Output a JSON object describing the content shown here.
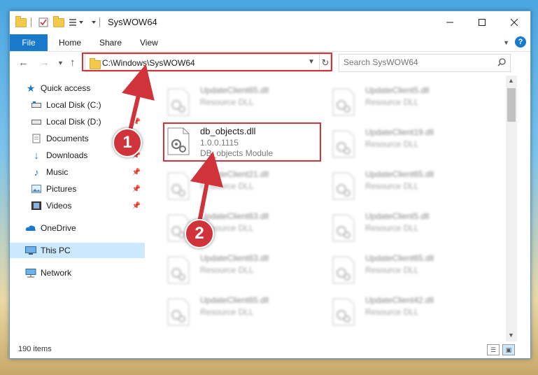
{
  "window": {
    "title": "SysWOW64"
  },
  "ribbon": {
    "tabs": [
      "File",
      "Home",
      "Share",
      "View"
    ],
    "help": "?"
  },
  "address": {
    "path": "C:\\Windows\\SysWOW64",
    "search_placeholder": "Search SysWOW64"
  },
  "sidebar": {
    "items": [
      {
        "label": "Quick access"
      },
      {
        "label": "Local Disk (C:)"
      },
      {
        "label": "Local Disk (D:)"
      },
      {
        "label": "Documents"
      },
      {
        "label": "Downloads"
      },
      {
        "label": "Music"
      },
      {
        "label": "Pictures"
      },
      {
        "label": "Videos"
      },
      {
        "label": "OneDrive"
      },
      {
        "label": "This PC"
      },
      {
        "label": "Network"
      }
    ]
  },
  "files": {
    "focus": {
      "name": "db_objects.dll",
      "version": "1.0.0.1115",
      "description": "DB_objects Module"
    },
    "left": [
      {
        "name": "UpdateClient65.dll",
        "desc": "Resource DLL"
      },
      {
        "name": "UpdateClient21.dll",
        "desc": "Resource DLL"
      },
      {
        "name": "UpdateClient63.dll",
        "desc": "Resource DLL"
      },
      {
        "name": "UpdateClient63.dll",
        "desc": "Resource DLL"
      },
      {
        "name": "UpdateClient65.dll",
        "desc": "Resource DLL"
      }
    ],
    "right": [
      {
        "name": "UpdateClient5.dll",
        "desc": "Resource DLL"
      },
      {
        "name": "UpdateClient19.dll",
        "desc": "Resource DLL"
      },
      {
        "name": "UpdateClient65.dll",
        "desc": "Resource DLL"
      },
      {
        "name": "UpdateClient5.dll",
        "desc": "Resource DLL"
      },
      {
        "name": "UpdateClient65.dll",
        "desc": "Resource DLL"
      },
      {
        "name": "UpdateClient42.dll",
        "desc": "Resource DLL"
      }
    ]
  },
  "status": {
    "count": "190 items"
  },
  "annotations": {
    "badge1": "1",
    "badge2": "2",
    "color": "#d0343a"
  }
}
